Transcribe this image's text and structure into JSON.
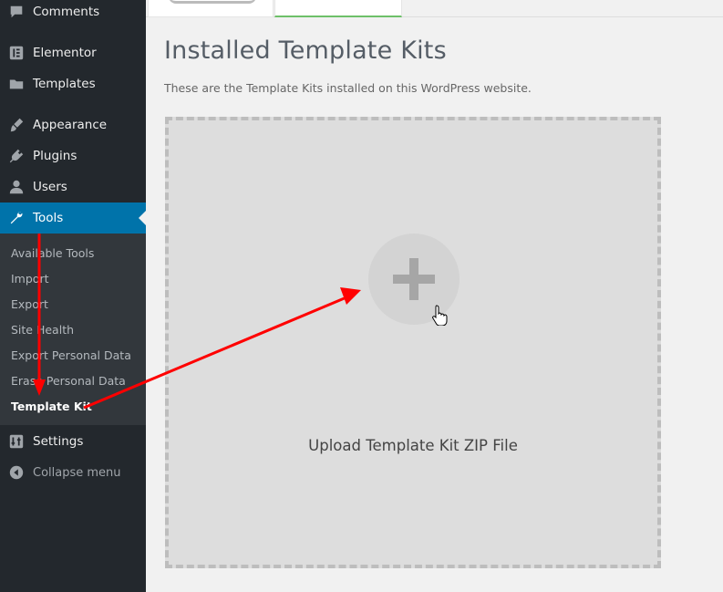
{
  "sidebar": {
    "menu": [
      {
        "label": "Comments",
        "icon": "comments-icon"
      },
      {
        "label": "Elementor",
        "icon": "elementor-icon"
      },
      {
        "label": "Templates",
        "icon": "folder-icon"
      },
      {
        "label": "Appearance",
        "icon": "paintbrush-icon"
      },
      {
        "label": "Plugins",
        "icon": "plugin-icon"
      },
      {
        "label": "Users",
        "icon": "user-icon"
      },
      {
        "label": "Tools",
        "icon": "wrench-icon"
      },
      {
        "label": "Settings",
        "icon": "settings-icon"
      }
    ],
    "submenu": [
      "Available Tools",
      "Import",
      "Export",
      "Site Health",
      "Export Personal Data",
      "Erase Personal Data",
      "Template Kit"
    ],
    "collapse_label": "Collapse menu",
    "active_item": "Tools",
    "current_submenu": "Template Kit"
  },
  "main": {
    "title": "Installed Template Kits",
    "description": "These are the Template Kits installed on this WordPress website.",
    "upload_label": "Upload Template Kit ZIP File"
  },
  "colors": {
    "sidebar_bg": "#23282d",
    "submenu_bg": "#32373c",
    "active_bg": "#0073aa",
    "annotation_arrow": "#ff0000",
    "tab_accent": "#6ec069"
  }
}
